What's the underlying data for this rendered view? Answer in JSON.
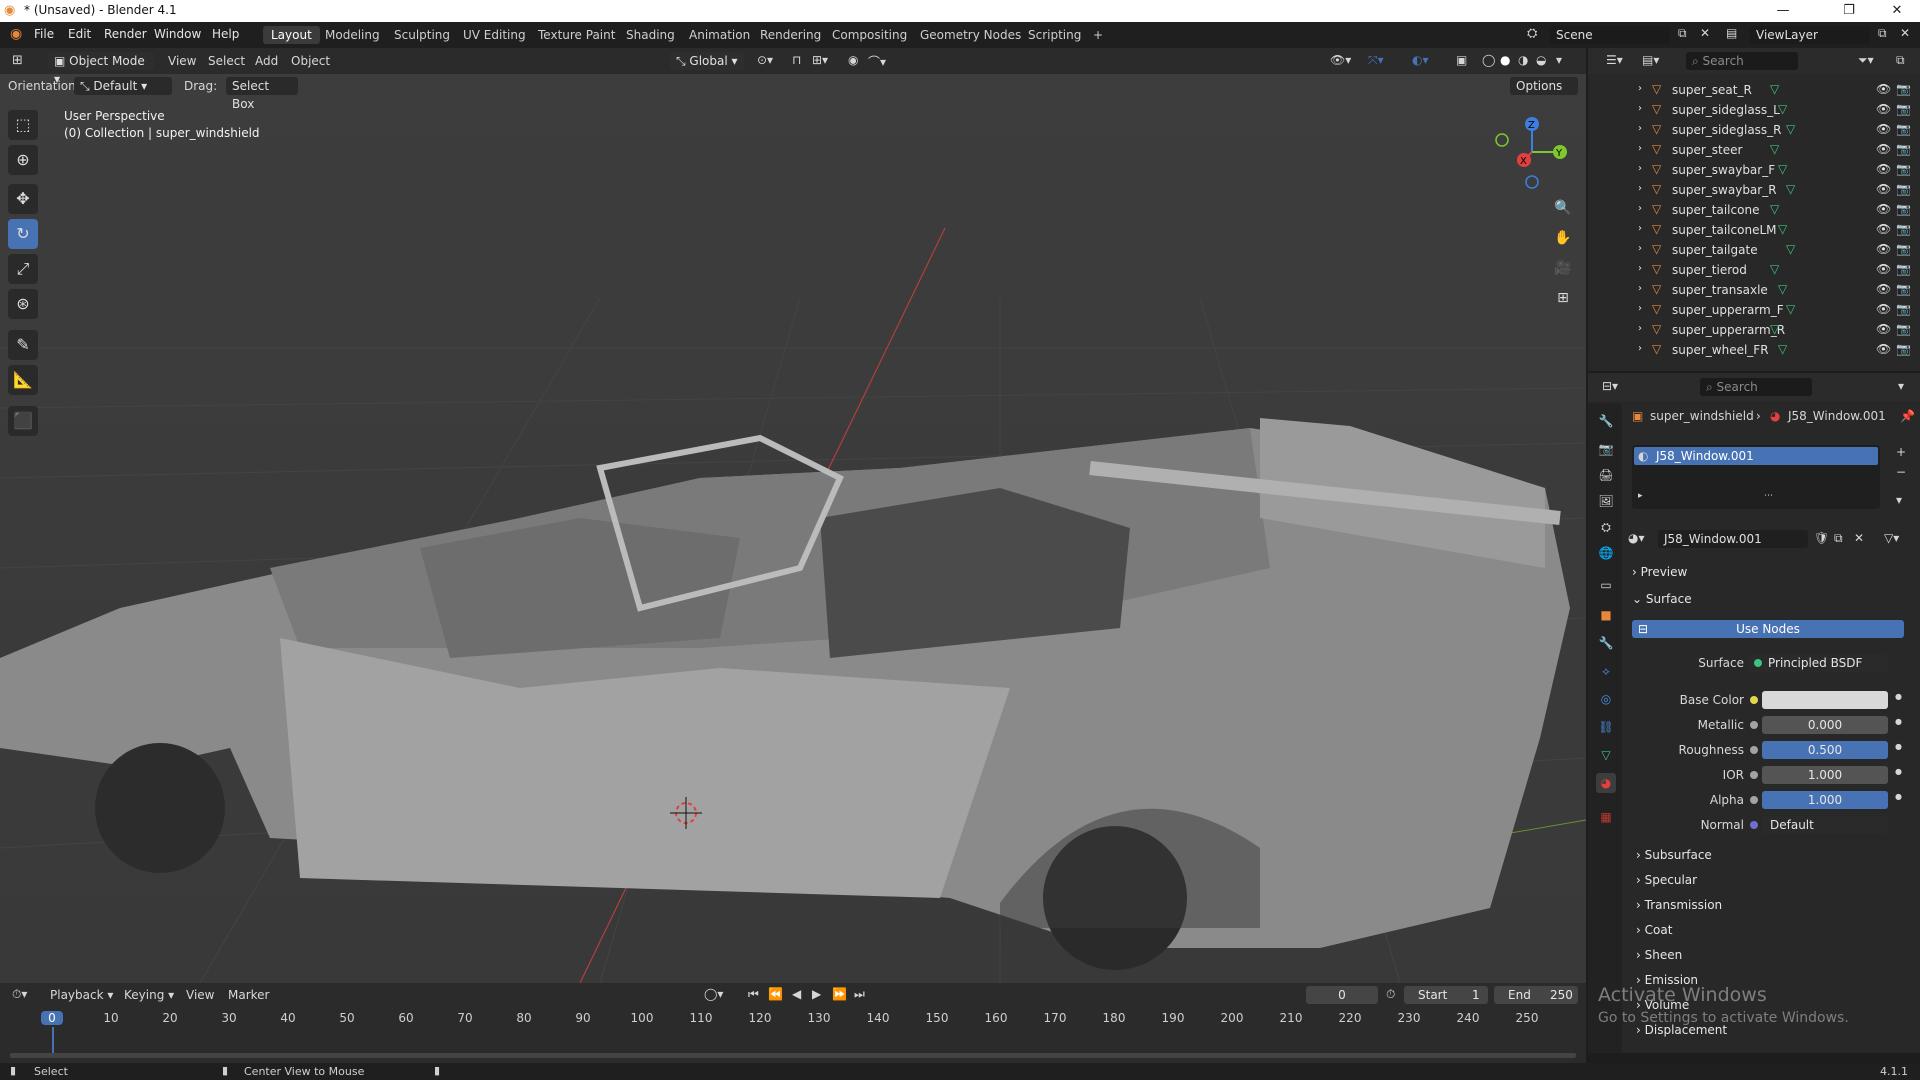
{
  "window": {
    "title": "* (Unsaved) - Blender 4.1",
    "minimize": "—",
    "maximize": "❐",
    "close": "✕"
  },
  "menubar": {
    "items": [
      "File",
      "Edit",
      "Render",
      "Window",
      "Help"
    ]
  },
  "workspaces": {
    "tabs": [
      "Layout",
      "Modeling",
      "Sculpting",
      "UV Editing",
      "Texture Paint",
      "Shading",
      "Animation",
      "Rendering",
      "Compositing",
      "Geometry Nodes",
      "Scripting"
    ],
    "active": "Layout",
    "add": "+"
  },
  "scene": {
    "name": "Scene",
    "view_layer": "ViewLayer"
  },
  "viewport": {
    "mode": "Object Mode",
    "menus": [
      "View",
      "Select",
      "Add",
      "Object"
    ],
    "transform": "Global",
    "orientation_label": "Orientation:",
    "orientation_value": "Default",
    "drag_label": "Drag:",
    "drag_value": "Select Box",
    "options": "Options",
    "overlay_title": "User Perspective",
    "overlay_subtitle": "(0) Collection | super_windshield",
    "gizmo": {
      "z": "Z",
      "y": "Y",
      "x": "X"
    }
  },
  "outliner": {
    "search_placeholder": "Search",
    "items": [
      "super_seat_R",
      "super_sideglass_L",
      "super_sideglass_R",
      "super_steer",
      "super_swaybar_F",
      "super_swaybar_R",
      "super_tailcone",
      "super_tailconeLM",
      "super_tailgate",
      "super_tierod",
      "super_transaxle",
      "super_upperarm_F",
      "super_upperarm_R",
      "super_wheel_FR"
    ]
  },
  "properties": {
    "search_placeholder": "Search",
    "breadcrumb_object": "super_windshield",
    "breadcrumb_material": "J58_Window.001",
    "slot": "J58_Window.001",
    "material_name": "J58_Window.001",
    "preview": "Preview",
    "surface": "Surface",
    "use_nodes": "Use Nodes",
    "surface_label": "Surface",
    "surface_value": "Principled BSDF",
    "fields": [
      {
        "label": "Base Color",
        "value": ""
      },
      {
        "label": "Metallic",
        "value": "0.000"
      },
      {
        "label": "Roughness",
        "value": "0.500"
      },
      {
        "label": "IOR",
        "value": "1.000"
      },
      {
        "label": "Alpha",
        "value": "1.000"
      },
      {
        "label": "Normal",
        "value": "Default"
      }
    ],
    "subpanels": [
      "Subsurface",
      "Specular",
      "Transmission",
      "Coat",
      "Sheen",
      "Emission",
      "Volume",
      "Displacement"
    ]
  },
  "timeline": {
    "menus": [
      "Playback",
      "Keying",
      "View",
      "Marker"
    ],
    "current_frame": "0",
    "start_label": "Start",
    "start": "1",
    "end_label": "End",
    "end": "250",
    "ticks": [
      "0",
      "10",
      "20",
      "30",
      "40",
      "50",
      "60",
      "70",
      "80",
      "90",
      "100",
      "110",
      "120",
      "130",
      "140",
      "150",
      "160",
      "170",
      "180",
      "190",
      "200",
      "210",
      "220",
      "230",
      "240",
      "250"
    ]
  },
  "statusbar": {
    "left": "Select",
    "middle": "Center View to Mouse",
    "version": "4.1.1"
  },
  "watermark": {
    "line1": "Activate Windows",
    "line2": "Go to Settings to activate Windows."
  },
  "colors": {
    "accent": "#4772b3",
    "object_orange": "#e8883a",
    "mesh_green": "#3cc47c",
    "x_red": "#e2403f",
    "y_green": "#7ec82d",
    "z_blue": "#3b7fe0"
  }
}
